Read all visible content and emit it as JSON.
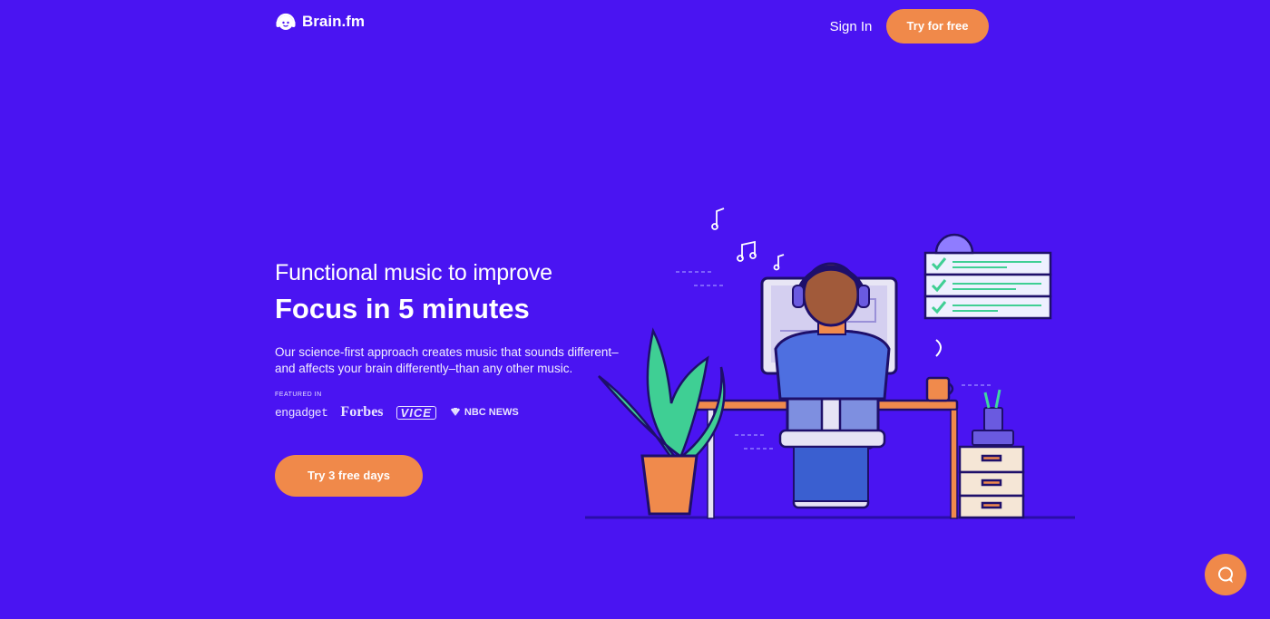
{
  "header": {
    "brand": "Brain.fm",
    "sign_in": "Sign In",
    "try_for_free": "Try for free"
  },
  "hero": {
    "kicker": "Functional music to improve",
    "headline": "Focus in 5 minutes",
    "description": "Our science-first approach creates music that sounds different–and affects your brain differently–than any other music.",
    "featured_label": "FEATURED IN",
    "press": [
      "engadget",
      "Forbes",
      "VICE",
      "NBC NEWS"
    ],
    "cta": "Try 3 free days"
  },
  "colors": {
    "background": "#4a14f2",
    "accent": "#f0894a",
    "text": "#ffffff"
  },
  "icons": {
    "logo": "headphones-face-icon",
    "chat": "chat-bubble-icon"
  }
}
